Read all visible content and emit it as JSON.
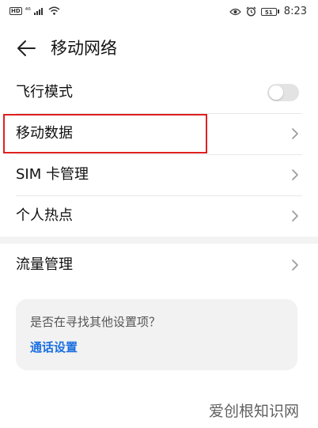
{
  "status_bar": {
    "hd_badge": "HD",
    "network": "⁴⁶",
    "battery_level": "51",
    "time": "8:23"
  },
  "header": {
    "title": "移动网络"
  },
  "items": [
    {
      "label": "飞行模式",
      "control": "toggle",
      "enabled": false
    },
    {
      "label": "移动数据",
      "control": "chevron",
      "highlighted": true
    },
    {
      "label": "SIM 卡管理",
      "control": "chevron"
    },
    {
      "label": "个人热点",
      "control": "chevron"
    },
    {
      "label": "流量管理",
      "control": "chevron"
    }
  ],
  "suggestion": {
    "question": "是否在寻找其他设置项？",
    "link": "通话设置"
  },
  "watermark": "爱创根知识网",
  "colors": {
    "accent": "#1a6fe0",
    "highlight": "#e02020",
    "toggle_off": "#e3e3e3",
    "card_bg": "#f2f2f2"
  }
}
